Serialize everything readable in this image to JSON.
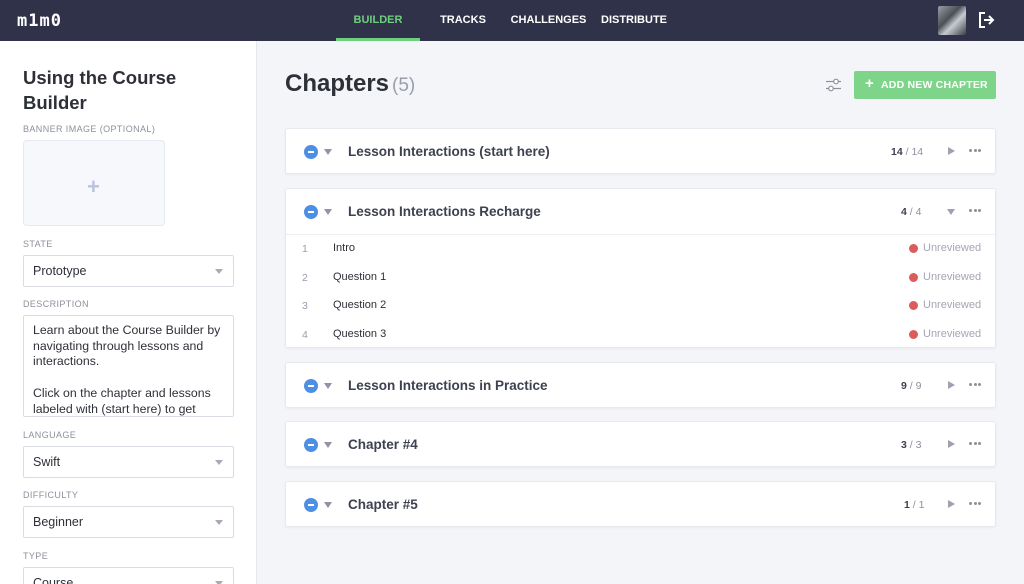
{
  "app": {
    "logo": "m1m0"
  },
  "nav": {
    "items": [
      {
        "label": "BUILDER",
        "active": true
      },
      {
        "label": "TRACKS",
        "active": false
      },
      {
        "label": "CHALLENGES",
        "active": false
      },
      {
        "label": "DISTRIBUTE",
        "active": false
      }
    ]
  },
  "sidebar": {
    "course_title": "Using the Course Builder",
    "banner_label": "BANNER IMAGE (OPTIONAL)",
    "state_label": "STATE",
    "state_value": "Prototype",
    "description_label": "DESCRIPTION",
    "description_p1": "Learn about the Course Builder by navigating through lessons and interactions.",
    "description_p2": "Click on the chapter and lessons labeled with (start here) to get",
    "language_label": "LANGUAGE",
    "language_value": "Swift",
    "difficulty_label": "DIFFICULTY",
    "difficulty_value": "Beginner",
    "type_label": "TYPE",
    "type_value": "Course"
  },
  "main": {
    "title": "Chapters",
    "count": "(5)",
    "add_button": "ADD NEW CHAPTER",
    "chapters": [
      {
        "name": "Lesson Interactions (start here)",
        "done": "14",
        "total": "/ 14",
        "expanded": false
      },
      {
        "name": "Lesson Interactions Recharge",
        "done": "4",
        "total": "/ 4",
        "expanded": true,
        "lessons": [
          {
            "num": "1",
            "name": "Intro",
            "status": "Unreviewed"
          },
          {
            "num": "2",
            "name": "Question 1",
            "status": "Unreviewed"
          },
          {
            "num": "3",
            "name": "Question 2",
            "status": "Unreviewed"
          },
          {
            "num": "4",
            "name": "Question 3",
            "status": "Unreviewed"
          }
        ]
      },
      {
        "name": "Lesson Interactions in Practice",
        "done": "9",
        "total": "/ 9",
        "expanded": false
      },
      {
        "name": "Chapter #4",
        "done": "3",
        "total": "/ 3",
        "expanded": false
      },
      {
        "name": "Chapter #5",
        "done": "1",
        "total": "/ 1",
        "expanded": false
      }
    ]
  },
  "colors": {
    "nav_bg": "#30324a",
    "accent_green": "#6ed07e",
    "add_button": "#7ed58a",
    "collapse_blue": "#4d8fe3",
    "status_red": "#dc5b5b"
  },
  "icons": [
    "logout-icon",
    "avatar",
    "filter-sliders-icon",
    "plus-icon",
    "minus-circle-icon",
    "chevron-down-icon",
    "play-icon",
    "more-dots-icon"
  ]
}
